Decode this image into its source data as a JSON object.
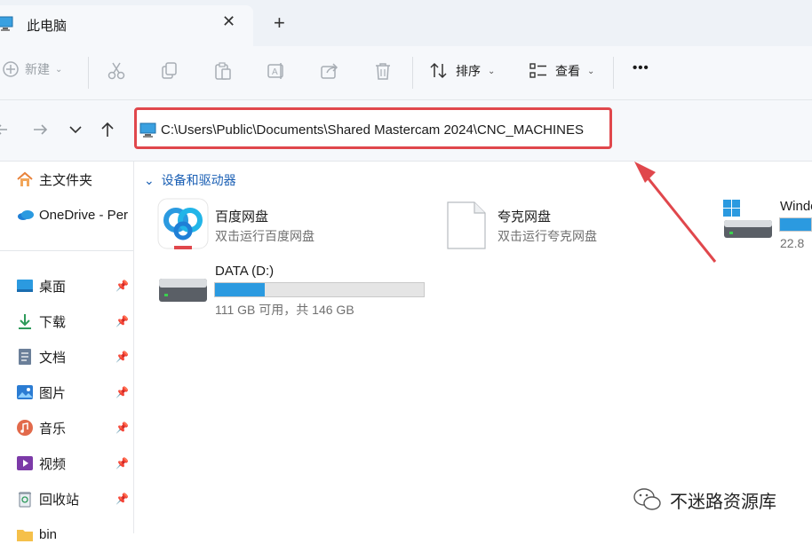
{
  "tab": {
    "title": "此电脑",
    "close_glyph": "✕",
    "new_tab_glyph": "+"
  },
  "toolbar": {
    "new_label": "新建",
    "sort_label": "排序",
    "view_label": "查看",
    "more_glyph": "•••"
  },
  "address": {
    "path": "C:\\Users\\Public\\Documents\\Shared Mastercam 2024\\CNC_MACHINES"
  },
  "sidebar": {
    "items": [
      {
        "label": "主文件夹",
        "icon": "home-icon"
      },
      {
        "label": "OneDrive - Per",
        "icon": "cloud-icon"
      },
      {
        "label": "桌面",
        "icon": "desktop-icon"
      },
      {
        "label": "下载",
        "icon": "download-icon"
      },
      {
        "label": "文档",
        "icon": "document-icon"
      },
      {
        "label": "图片",
        "icon": "picture-icon"
      },
      {
        "label": "音乐",
        "icon": "music-icon"
      },
      {
        "label": "视频",
        "icon": "video-icon"
      },
      {
        "label": "回收站",
        "icon": "recycle-bin-icon"
      },
      {
        "label": "bin",
        "icon": "folder-icon"
      }
    ]
  },
  "content": {
    "group_title": "设备和驱动器",
    "items": [
      {
        "title": "百度网盘",
        "subtitle": "双击运行百度网盘",
        "icon": "baidu-netdisk-icon"
      },
      {
        "title": "夸克网盘",
        "subtitle": "双击运行夸克网盘",
        "icon": "file-icon"
      },
      {
        "title": "Windo",
        "subtitle": "22.8",
        "icon": "windows-drive-icon",
        "fill": 1.0
      },
      {
        "title": "DATA (D:)",
        "subtitle": "111 GB 可用，共 146 GB",
        "icon": "drive-icon",
        "fill": 0.24
      }
    ]
  },
  "watermark": "不迷路资源库",
  "colors": {
    "accent": "#2b9ae0",
    "highlight_border": "#e0474c",
    "arrow": "#e0474c"
  }
}
